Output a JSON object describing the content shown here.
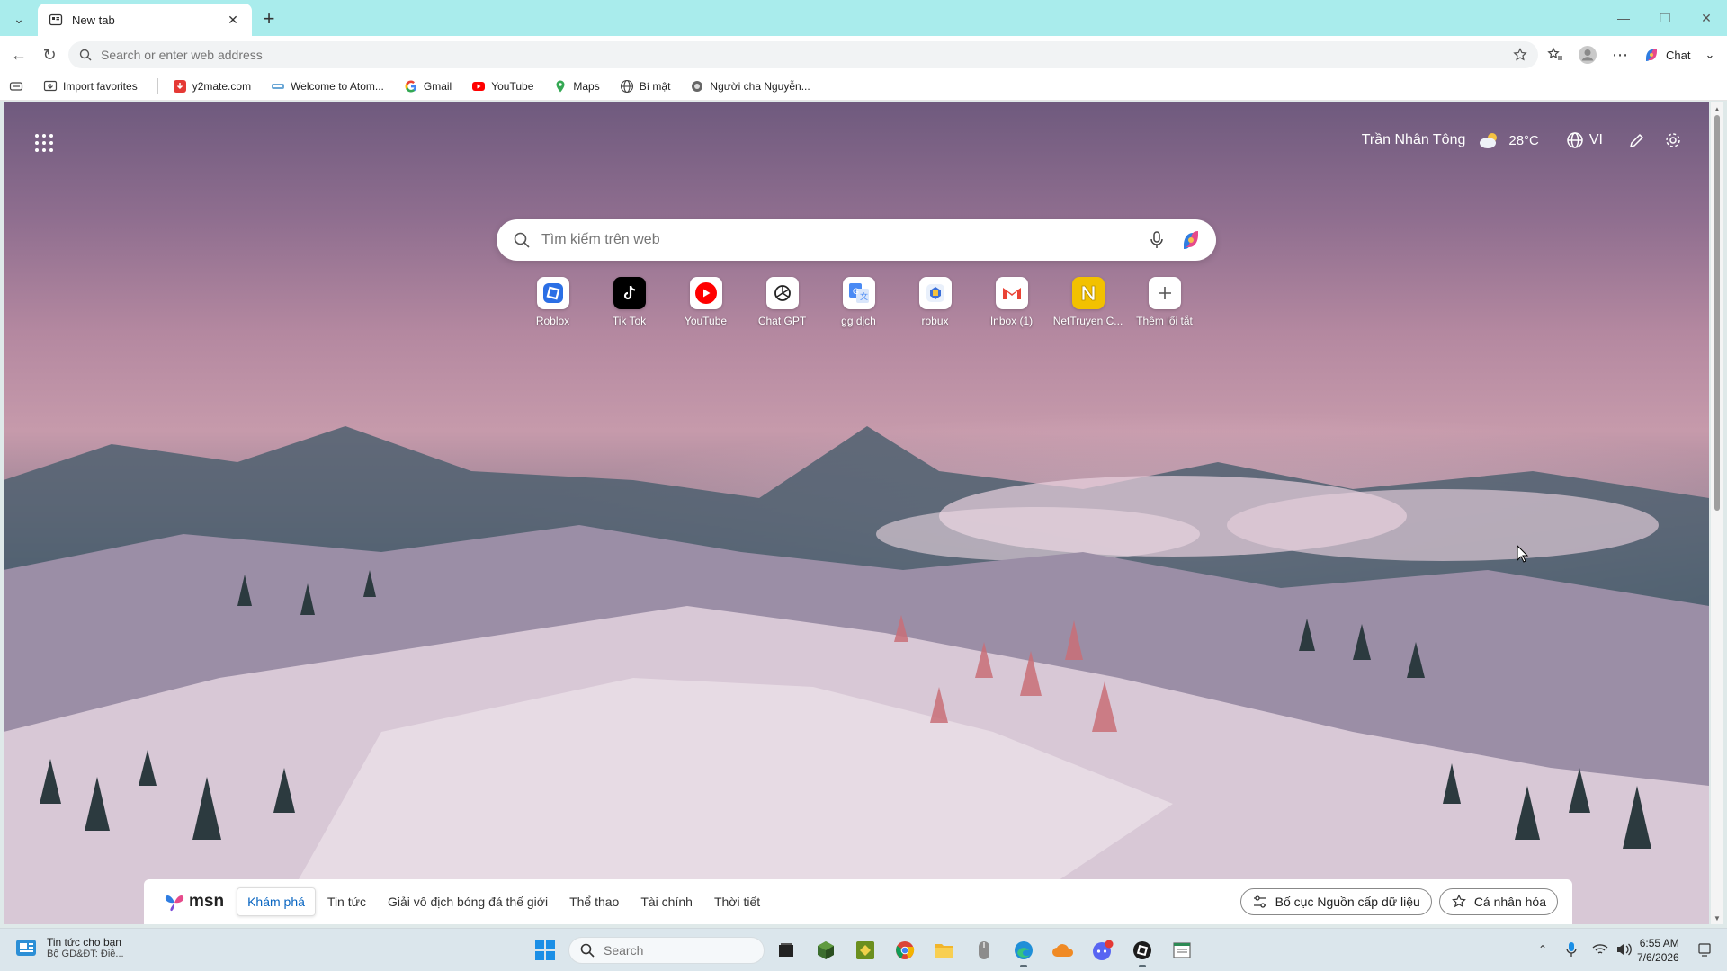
{
  "browser": {
    "tab_title": "New tab",
    "address_placeholder": "Search or enter web address",
    "chat_label": "Chat"
  },
  "favorites": [
    {
      "label": "Import favorites",
      "icon": "import-icon"
    },
    {
      "label": "y2mate.com",
      "icon": "y2mate-icon"
    },
    {
      "label": "Welcome to Atom...",
      "icon": "atom-icon"
    },
    {
      "label": "Gmail",
      "icon": "google-icon"
    },
    {
      "label": "YouTube",
      "icon": "youtube-icon"
    },
    {
      "label": "Maps",
      "icon": "maps-icon"
    },
    {
      "label": "Bí mật",
      "icon": "globe-icon"
    },
    {
      "label": "Người cha Nguyễn...",
      "icon": "site-icon"
    }
  ],
  "header": {
    "location": "Trần Nhân Tông",
    "temperature": "28°C",
    "language": "VI"
  },
  "search": {
    "placeholder": "Tìm kiếm trên web"
  },
  "quick_links": [
    {
      "label": "Roblox",
      "icon": "roblox-icon",
      "color": "#2b6fe5"
    },
    {
      "label": "Tik Tok",
      "icon": "tiktok-icon",
      "color": "#000000"
    },
    {
      "label": "YouTube",
      "icon": "youtube-icon",
      "color": "#ff0000"
    },
    {
      "label": "Chat GPT",
      "icon": "chatgpt-icon",
      "color": "#222222"
    },
    {
      "label": "gg dịch",
      "icon": "google-translate-icon",
      "color": "#4a8af4"
    },
    {
      "label": "robux",
      "icon": "robux-icon",
      "color": "#3b6fd8"
    },
    {
      "label": "Inbox (1)",
      "icon": "gmail-icon",
      "color": "#ea4335"
    },
    {
      "label": "NetTruyen C...",
      "icon": "nettruyen-icon",
      "color": "#f2c100"
    },
    {
      "label": "Thêm lối tắt",
      "icon": "plus-icon",
      "color": "#555555"
    }
  ],
  "msn": {
    "logo": "msn",
    "tabs": [
      {
        "label": "Khám phá",
        "active": true
      },
      {
        "label": "Tin tức",
        "active": false
      },
      {
        "label": "Giải vô địch bóng đá thế giới",
        "active": false
      },
      {
        "label": "Thể thao",
        "active": false
      },
      {
        "label": "Tài chính",
        "active": false
      },
      {
        "label": "Thời tiết",
        "active": false
      }
    ],
    "layout_button": "Bố cục Nguồn cấp dữ liệu",
    "personalize_button": "Cá nhân hóa"
  },
  "taskbar": {
    "news_title": "Tin tức cho bạn",
    "news_subtitle": "Bộ GD&ĐT: Điề...",
    "search_placeholder": "Search",
    "time": "6:55 AM",
    "date": "7/6/2026"
  }
}
